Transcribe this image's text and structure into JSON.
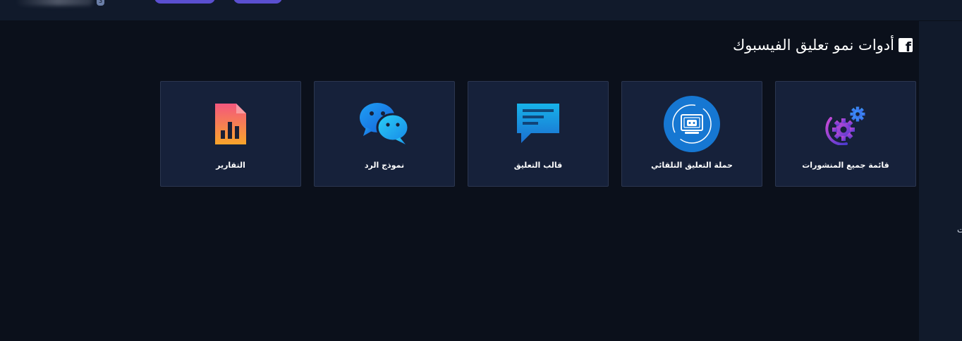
{
  "header": {
    "badge": "3"
  },
  "page": {
    "title": "أدوات نمو تعليق الفيسبوك",
    "title_icon": "facebook-icon"
  },
  "cards": [
    {
      "label": "قائمة جميع المنشورات",
      "icon": "gears-icon"
    },
    {
      "label": "حملة التعليق التلقائي",
      "icon": "robot-icon"
    },
    {
      "label": "قالب التعليق",
      "icon": "comment-template-icon"
    },
    {
      "label": "نموذج الرد",
      "icon": "chat-bubbles-icon"
    },
    {
      "label": "التقارير",
      "icon": "report-file-icon"
    }
  ],
  "side_panel": {
    "glyph": "ت"
  },
  "colors": {
    "background": "#0b101b",
    "card": "#16213a",
    "card_border": "#2b3650",
    "accent": "#5a4fd0"
  }
}
